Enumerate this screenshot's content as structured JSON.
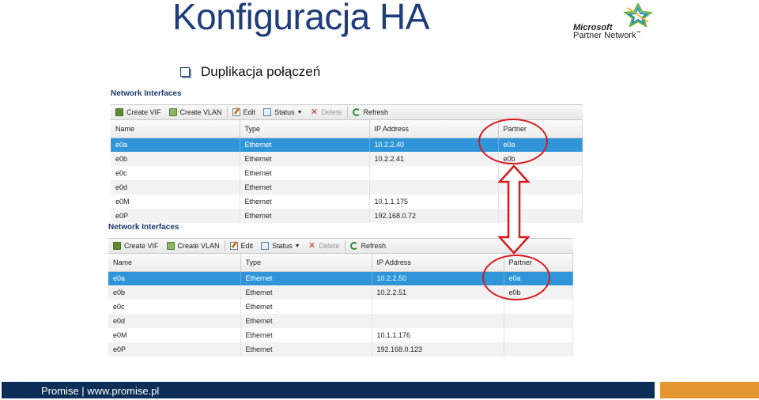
{
  "slide": {
    "title": "Konfiguracja HA",
    "bullet": "Duplikacja połączeń",
    "footer": "Promise | www.promise.pl"
  },
  "logo": {
    "brand": "Microsoft",
    "program": "Partner Network",
    "trademark": "™"
  },
  "colors": {
    "title": "#1f3d7a",
    "selection": "#2f95d8",
    "highlight_circle": "#d71920",
    "footer_bar": "#0d2f57",
    "footer_accent": "#e3962e"
  },
  "panels": [
    {
      "title": "Network Interfaces",
      "toolbar": {
        "create_vif": "Create VIF",
        "create_vlan": "Create VLAN",
        "edit": "Edit",
        "status": "Status",
        "delete": "Delete",
        "refresh": "Refresh"
      },
      "columns": [
        "Name",
        "Type",
        "IP Address",
        "Partner"
      ],
      "rows": [
        [
          "e0a",
          "Ethernet",
          "10.2.2.40",
          "e0a"
        ],
        [
          "e0b",
          "Ethernet",
          "10.2.2.41",
          "e0b"
        ],
        [
          "e0c",
          "Ethernet",
          "",
          ""
        ],
        [
          "e0d",
          "Ethernet",
          "",
          ""
        ],
        [
          "e0M",
          "Ethernet",
          "10.1.1.175",
          ""
        ],
        [
          "e0P",
          "Ethernet",
          "192.168.0.72",
          ""
        ]
      ],
      "selected_row": 0
    },
    {
      "title": "Network Interfaces",
      "toolbar": {
        "create_vif": "Create VIF",
        "create_vlan": "Create VLAN",
        "edit": "Edit",
        "status": "Status",
        "delete": "Delete",
        "refresh": "Refresh"
      },
      "columns": [
        "Name",
        "Type",
        "IP Address",
        "Partner"
      ],
      "rows": [
        [
          "e0a",
          "Ethernet",
          "10.2.2.50",
          "e0a"
        ],
        [
          "e0b",
          "Ethernet",
          "10.2.2.51",
          "e0b"
        ],
        [
          "e0c",
          "Ethernet",
          "",
          ""
        ],
        [
          "e0d",
          "Ethernet",
          "",
          ""
        ],
        [
          "e0M",
          "Ethernet",
          "10.1.1.176",
          ""
        ],
        [
          "e0P",
          "Ethernet",
          "192.168.0.123",
          ""
        ]
      ],
      "selected_row": 0
    }
  ]
}
